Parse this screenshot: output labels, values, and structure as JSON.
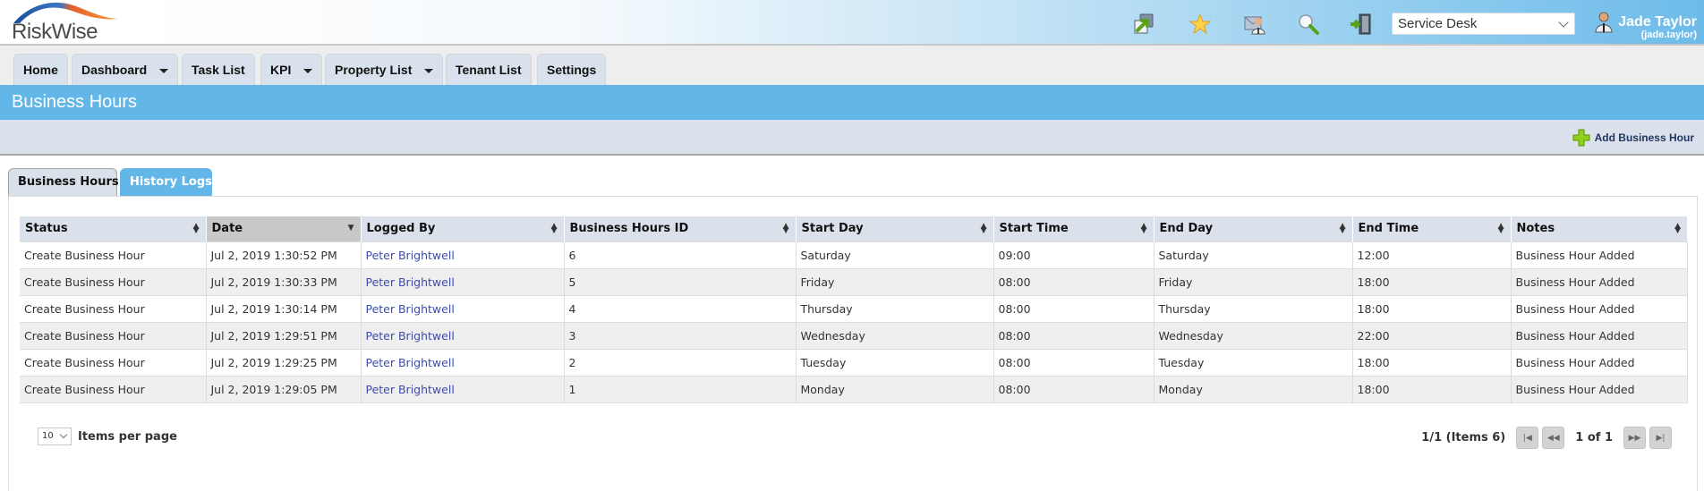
{
  "header": {
    "logo_text": "RiskWise",
    "service_select": {
      "selected": "Service Desk"
    },
    "icons": [
      "switch-window-icon",
      "favorites-star-icon",
      "support-agent-icon",
      "search-icon",
      "logout-door-icon"
    ],
    "user": {
      "name": "Jade Taylor",
      "login": "(jade.taylor)"
    }
  },
  "nav": {
    "items": [
      {
        "label": "Home",
        "has_dropdown": false
      },
      {
        "label": "Dashboard",
        "has_dropdown": true
      },
      {
        "label": "Task List",
        "has_dropdown": false
      },
      {
        "label": "KPI",
        "has_dropdown": true
      },
      {
        "label": "Property List",
        "has_dropdown": true
      },
      {
        "label": "Tenant List",
        "has_dropdown": false
      },
      {
        "label": "Settings",
        "has_dropdown": false
      }
    ]
  },
  "page": {
    "title": "Business Hours",
    "add_button_label": "Add Business Hour"
  },
  "content_tabs": [
    {
      "label": "Business Hours",
      "active": false
    },
    {
      "label": "History Logs",
      "active": true
    }
  ],
  "table": {
    "columns": [
      "Status",
      "Date",
      "Logged By",
      "Business Hours ID",
      "Start Day",
      "Start Time",
      "End Day",
      "End Time",
      "Notes"
    ],
    "sorted_column": "Date",
    "rows": [
      [
        "Create Business Hour",
        "Jul 2, 2019 1:30:52 PM",
        "Peter Brightwell",
        "6",
        "Saturday",
        "09:00",
        "Saturday",
        "12:00",
        "Business Hour Added"
      ],
      [
        "Create Business Hour",
        "Jul 2, 2019 1:30:33 PM",
        "Peter Brightwell",
        "5",
        "Friday",
        "08:00",
        "Friday",
        "18:00",
        "Business Hour Added"
      ],
      [
        "Create Business Hour",
        "Jul 2, 2019 1:30:14 PM",
        "Peter Brightwell",
        "4",
        "Thursday",
        "08:00",
        "Thursday",
        "18:00",
        "Business Hour Added"
      ],
      [
        "Create Business Hour",
        "Jul 2, 2019 1:29:51 PM",
        "Peter Brightwell",
        "3",
        "Wednesday",
        "08:00",
        "Wednesday",
        "22:00",
        "Business Hour Added"
      ],
      [
        "Create Business Hour",
        "Jul 2, 2019 1:29:25 PM",
        "Peter Brightwell",
        "2",
        "Tuesday",
        "08:00",
        "Tuesday",
        "18:00",
        "Business Hour Added"
      ],
      [
        "Create Business Hour",
        "Jul 2, 2019 1:29:05 PM",
        "Peter Brightwell",
        "1",
        "Monday",
        "08:00",
        "Monday",
        "18:00",
        "Business Hour Added"
      ]
    ]
  },
  "pager": {
    "items_per_page": "10",
    "items_per_page_label": "Items per page",
    "summary": "1/1 (Items 6)",
    "current": "1 of 1"
  },
  "colors": {
    "accent": "#62b7e8",
    "link": "#3d4cae",
    "header_row": "#dbe1ea",
    "sorted_header": "#c8c8c8"
  }
}
